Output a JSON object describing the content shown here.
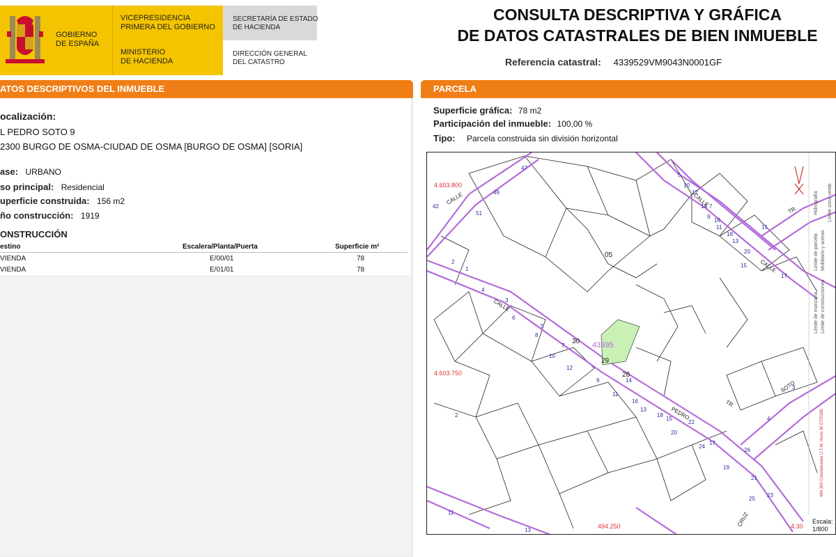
{
  "header": {
    "gov_line1": "GOBIERNO",
    "gov_line2": "DE ESPAÑA",
    "vice_line1": "VICEPRESIDENCIA",
    "vice_line2": "PRIMERA DEL GOBIERNO",
    "min_line1": "MINISTERIO",
    "min_line2": "DE HACIENDA",
    "sec_line1": "SECRETARÍA DE ESTADO",
    "sec_line2": "DE HACIENDA",
    "dir_line1": "DIRECCIÓN GENERAL",
    "dir_line2": "DEL CATASTRO",
    "title_line1": "CONSULTA DESCRIPTIVA Y GRÁFICA",
    "title_line2": "DE DATOS CATASTRALES DE BIEN INMUEBLE",
    "ref_label": "Referencia catastral:",
    "ref_value": "4339529VM9043N0001GF"
  },
  "left": {
    "section_title": "ATOS DESCRIPTIVOS DEL INMUEBLE",
    "loc_label": "ocalización:",
    "addr1": "L PEDRO SOTO 9",
    "addr2": "2300 BURGO DE OSMA-CIUDAD DE OSMA [BURGO DE OSMA] [SORIA]",
    "clase_label": "ase:",
    "clase_value": "URBANO",
    "uso_label": "so principal:",
    "uso_value": "Residencial",
    "sup_label": "uperficie construida:",
    "sup_value": "156 m2",
    "anio_label": "ño construcción:",
    "anio_value": "1919",
    "constr_title": "ONSTRUCCIÓN",
    "table": {
      "headers": [
        "estino",
        "Escalera/Planta/Puerta",
        "Superficie m²"
      ],
      "rows": [
        [
          "VIENDA",
          "E/00/01",
          "78"
        ],
        [
          "VIENDA",
          "E/01/01",
          "78"
        ]
      ]
    }
  },
  "right": {
    "section_title": "PARCELA",
    "sup_label": "Superficie gráfica:",
    "sup_value": "78 m2",
    "part_label": "Participación del inmueble:",
    "part_value": "100,00 %",
    "tipo_label": "Tipo:",
    "tipo_value": "Parcela construida sin división horizontal"
  },
  "map": {
    "coords": [
      "4.603.800",
      "4.603.750",
      "494.250",
      "4.30"
    ],
    "parcel_ref": "43395",
    "parcel_labels": [
      "05",
      "30",
      "29",
      "28"
    ],
    "street_numbers": [
      "47",
      "49",
      "51",
      "42",
      "2",
      "1",
      "4",
      "3",
      "6",
      "5",
      "8",
      "7",
      "10",
      "12",
      "9",
      "14",
      "11",
      "16",
      "13",
      "18",
      "15",
      "20",
      "22",
      "17",
      "24",
      "19",
      "26",
      "21",
      "25",
      "23",
      "5",
      "10",
      "12",
      "14",
      "16",
      "18",
      "20",
      "7",
      "9",
      "11",
      "13",
      "15",
      "17",
      "15",
      "2",
      "3",
      "4",
      "13",
      "11"
    ],
    "street_names": [
      "CALLE",
      "CALLE",
      "CALLE",
      "PEDRO",
      "TR.",
      "TR.",
      "CALLE",
      "TR.",
      "CRUZ",
      "SOTO"
    ],
    "legend": {
      "items": [
        "Límite de manzana",
        "Límite de parcela",
        "Límite de construcciones",
        "Mobiliario y aceras",
        "Límite zona verde",
        "Hidrografía"
      ],
      "coord_system": "494.300 Coordenadas U.T.M. Huso 30 ETRS89",
      "scale_label": "Escala:",
      "scale_value": "1/800"
    },
    "colors": {
      "street": "#b36bd9",
      "parcel_fill": "#c9f0b5",
      "coord_text": "#d33",
      "frame": "#222"
    }
  }
}
